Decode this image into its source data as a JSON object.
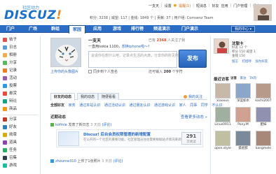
{
  "header": {
    "logo_tag": "社区动力",
    "logo_word": "DISCUZ",
    "logo_bang": "!",
    "top_links": {
      "user": "一支天",
      "settings": "设置",
      "notice": "提醒(1)",
      "messages": "短消息",
      "friends": "好友",
      "apps": "应用",
      "admin": "门户管理",
      "logout": "退出"
    },
    "info": "积分: 3238 | 威望: 117 | 金钱: 1849 个 | 贡献: 37 | 用户组: Comsenz Team"
  },
  "nav": {
    "items": [
      "门户",
      "广场",
      "群组",
      "家园",
      "应用",
      "游戏",
      "排行榜",
      "频道演示",
      "门户演示"
    ],
    "active": 3,
    "my_center": "我的中心 ▾"
  },
  "sidebar": {
    "items": [
      {
        "label": "帖子",
        "icon": "post-icon",
        "color": "#d9534f"
      },
      {
        "label": "日志",
        "icon": "blog-icon",
        "color": "#5b9bd5"
      },
      {
        "label": "相册",
        "icon": "album-icon",
        "color": "#f0ad4e"
      },
      {
        "label": "分享",
        "icon": "share-icon",
        "color": "#5cb85c"
      },
      {
        "label": "记录",
        "icon": "doing-icon",
        "color": "#e67e22"
      },
      {
        "label": "活动",
        "icon": "activity-icon",
        "color": "#9b59b6"
      },
      {
        "label": "投票",
        "icon": "poll-icon",
        "color": "#3498db"
      },
      {
        "label": "悬赏",
        "icon": "reward-icon",
        "color": "#e74c3c"
      },
      {
        "label": "辩论",
        "icon": "debate-icon",
        "color": "#16a085"
      },
      {
        "label": "商品",
        "icon": "goods-icon",
        "color": "#f39c12"
      },
      {
        "label": "分享",
        "icon": "share2-icon",
        "color": "#c0392b"
      },
      {
        "label": "好友",
        "icon": "friends-icon",
        "color": "#2980b9"
      },
      {
        "label": "勋章",
        "icon": "medal-icon",
        "color": "#d4ac0d"
      },
      {
        "label": "道具",
        "icon": "magic-icon",
        "color": "#8e44ad"
      },
      {
        "label": "任务",
        "icon": "task-icon",
        "color": "#27ae60"
      },
      {
        "label": "召集",
        "icon": "invite-icon",
        "color": "#2c3e50"
      },
      {
        "label": "游戏",
        "icon": "game-icon",
        "color": "#1abc9c"
      }
    ]
  },
  "main": {
    "pic_caption": "上传你的头像图片",
    "username": "一支天",
    "status_prefix": "一直用nokia 1100，",
    "status_link": "想换iphone啦～",
    "status_suffix": "！",
    "counter_prefix": "已有",
    "counter_num": "2368",
    "counter_suffix": "人关注了我",
    "composer_placeholder": "说说你在想什么吧，记录点生活的点滴，分享你的所见所闻……",
    "publish_label": "发布",
    "sync_label": "同步到个人签名",
    "limit_prefix": "还可输入",
    "limit_num": "200",
    "limit_suffix": "个字符",
    "tabs": [
      "好友的动态",
      "我的动态",
      "随便看看"
    ],
    "active_tab": 0,
    "tab_right": "我的关注",
    "filters": [
      "全部好友",
      "家务",
      "通过本站认识",
      "通过活动认识",
      "通过朋友认识",
      "通过游戏认识",
      "家人",
      "同事",
      "同学",
      "不认识"
    ],
    "section_title": "近期动态",
    "section_more": "查看更多动态 »",
    "feed": [
      {
        "user": "kofmle",
        "action": "发表了新日志",
        "time": "3 天前",
        "via": "(评论)",
        "title": "Discuz! 后台会员权限管理的新增配置",
        "desc": "在公开的一个社区的重要功能，社区管理员往往需要根据站点情况来调整配置项…",
        "count": "291",
        "count_label": "次阅读"
      },
      {
        "user": "zhourne310",
        "action": "上传了1张照片",
        "time": "3 天前",
        "via": "(评论)"
      }
    ]
  },
  "right": {
    "name": "沈聪卡",
    "stats": [
      "好友 12 个",
      "积分 150 威望 1",
      "金钱 150"
    ],
    "links": [
      "留言",
      "打招呼",
      "加为好友"
    ],
    "visitors_title": "最近访客",
    "visitor_tabs": [
      "访客",
      "来访",
      "TA的"
    ],
    "visitors": [
      "xiaoxun",
      "深蓝如水",
      "kachi2007",
      "Linus0911",
      "Pony.M",
      "肥妹",
      "open.style",
      "孤星醉",
      "kangmele"
    ]
  }
}
